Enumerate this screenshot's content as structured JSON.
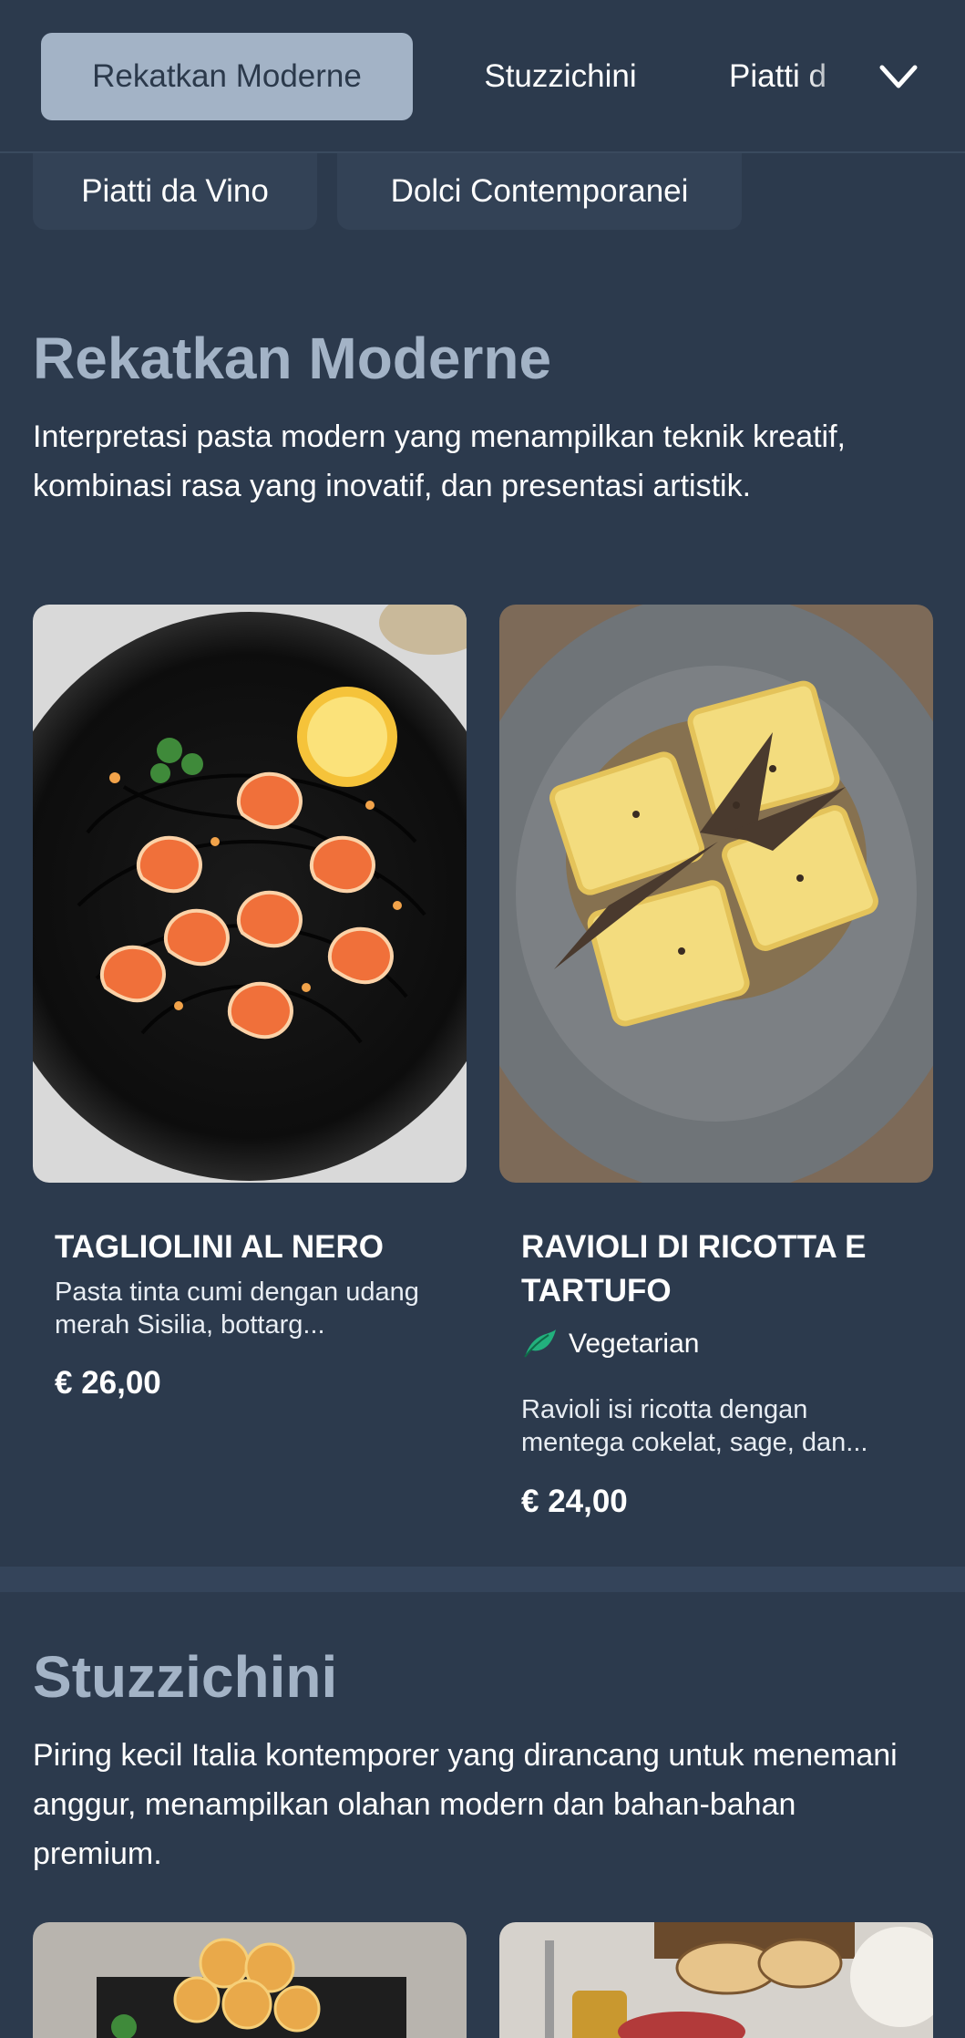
{
  "nav": {
    "tabs": [
      "Rekatkan Moderne",
      "Stuzzichini",
      "Piatti d"
    ],
    "pills": [
      "Piatti da Vino",
      "Dolci Contemporanei"
    ]
  },
  "sections": [
    {
      "title": "Rekatkan Moderne",
      "description": "Interpretasi pasta modern yang menampilkan teknik kreatif, kombinasi rasa yang inovatif, dan presentasi artistik.",
      "items": [
        {
          "name": "TAGLIOLINI AL NERO",
          "description": "Pasta tinta cumi dengan udang merah Sisilia, bottarg...",
          "price": "€ 26,00"
        },
        {
          "name": "RAVIOLI DI RICOTTA E TARTUFO",
          "badge": "Vegetarian",
          "description": "Ravioli isi ricotta dengan mentega cokelat, sage, dan...",
          "price": "€ 24,00"
        }
      ]
    },
    {
      "title": "Stuzzichini",
      "description": "Piring kecil Italia kontemporer yang dirancang untuk menemani anggur, menampilkan olahan modern dan bahan-bahan premium."
    }
  ],
  "colors": {
    "background": "#2c3a4d",
    "active_tab": "#a3b3c6",
    "section_title": "#a3b3c6",
    "vegetarian_icon": "#22b07d"
  },
  "icons": [
    "chevron-down-icon",
    "vegetarian-icon"
  ]
}
